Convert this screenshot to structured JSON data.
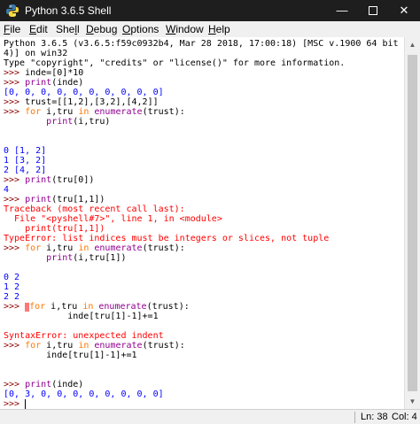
{
  "window": {
    "title": "Python 3.6.5 Shell",
    "minimize_label": "—",
    "close_label": "✕"
  },
  "menu": {
    "file": {
      "accel": "F",
      "rest": "ile"
    },
    "edit": {
      "accel": "E",
      "rest": "dit"
    },
    "shell": {
      "pre": "She",
      "accel": "l",
      "rest": "l"
    },
    "debug": {
      "accel": "D",
      "rest": "ebug"
    },
    "options": {
      "accel": "O",
      "rest": "ptions"
    },
    "window": {
      "accel": "W",
      "rest": "indow"
    },
    "help": {
      "accel": "H",
      "rest": "elp"
    }
  },
  "shell": {
    "banner1": "Python 3.6.5 (v3.6.5:f59c0932b4, Mar 28 2018, 17:00:18) [MSC v.1900 64 bit (AMD6",
    "banner2": "4)] on win32",
    "banner3": "Type \"copyright\", \"credits\" or \"license()\" for more information.",
    "prompt": ">>> ",
    "l4_code": "inde=[0]*10",
    "l5_fn": "print",
    "l5_arg": "(inde)",
    "l6_out": "[0, 0, 0, 0, 0, 0, 0, 0, 0, 0]",
    "l7_code": "trust=[[1,2],[3,2],[4,2]]",
    "l8_for": "for",
    "l8_mid": " i,tru ",
    "l8_in": "in",
    "l8_sp": " ",
    "l8_enum": "enumerate",
    "l8_end": "(trust):",
    "l9_indent": "        ",
    "l9_fn": "print",
    "l9_arg": "(i,tru)",
    "o1": "0 [1, 2]",
    "o2": "1 [3, 2]",
    "o3": "2 [4, 2]",
    "l14_fn": "print",
    "l14_arg": "(tru[0])",
    "l15_out": "4",
    "l16_fn": "print",
    "l16_arg": "(tru[1,1])",
    "tb1": "Traceback (most recent call last):",
    "tb2": "  File \"<pyshell#7>\", line 1, in <module>",
    "tb3": "    print(tru[1,1])",
    "tb4": "TypeError: list indices must be integers or slices, not tuple",
    "l21_for": "for",
    "l21_mid": " i,tru ",
    "l21_in": "in",
    "l21_sp": " ",
    "l21_enum": "enumerate",
    "l21_end": "(trust):",
    "l22_indent": "        ",
    "l22_fn": "print",
    "l22_arg": "(i,tru[1])",
    "o4": "0 2",
    "o5": "1 2",
    "o6": "2 2",
    "l29_for": "for",
    "l29_mid": " i,tru ",
    "l29_in": "in",
    "l29_sp": " ",
    "l29_enum": "enumerate",
    "l29_end": "(trust):",
    "l30_code": "            inde[tru[1]-1]+=1",
    "syn_err": "SyntaxError: unexpected indent",
    "l33_for": "for",
    "l33_mid": " i,tru ",
    "l33_in": "in",
    "l33_sp": " ",
    "l33_enum": "enumerate",
    "l33_end": "(trust):",
    "l34_code": "        inde[tru[1]-1]+=1",
    "l37_fn": "print",
    "l37_arg": "(inde)",
    "l38_out": "[0, 3, 0, 0, 0, 0, 0, 0, 0, 0]"
  },
  "status": {
    "line": "Ln: 38",
    "col": "Col: 4"
  },
  "colors": {
    "title_bar": "#1e1e1e",
    "output": "#0000ff",
    "error": "#ff0000",
    "keyword": "#ff7700",
    "builtin": "#900090",
    "prompt": "#8b0000"
  }
}
